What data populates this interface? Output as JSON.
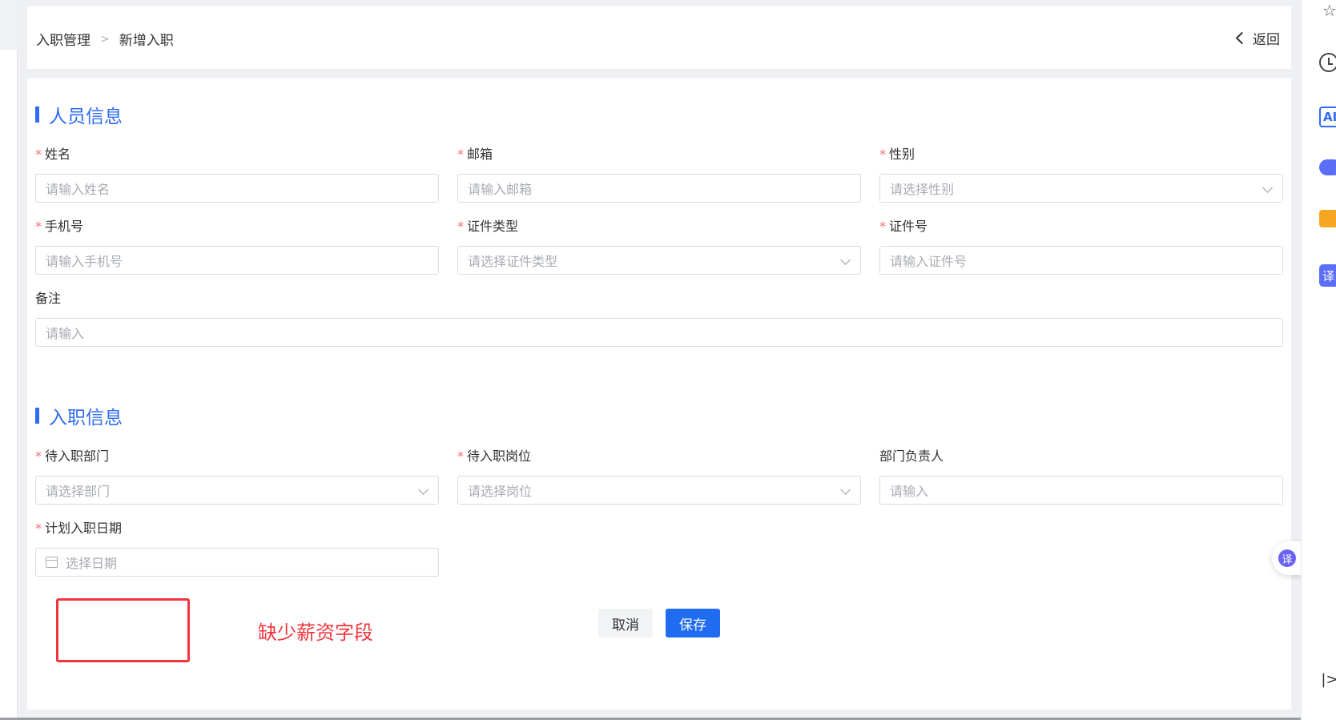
{
  "breadcrumb": {
    "parent": "入职管理",
    "current": "新增入职"
  },
  "back_label": "返回",
  "personal": {
    "title": "人员信息",
    "name": {
      "label": "姓名",
      "placeholder": "请输入姓名"
    },
    "email": {
      "label": "邮箱",
      "placeholder": "请输入邮箱"
    },
    "gender": {
      "label": "性别",
      "placeholder": "请选择性别"
    },
    "phone": {
      "label": "手机号",
      "placeholder": "请输入手机号"
    },
    "id_type": {
      "label": "证件类型",
      "placeholder": "请选择证件类型"
    },
    "id_number": {
      "label": "证件号",
      "placeholder": "请输入证件号"
    },
    "remark": {
      "label": "备注",
      "placeholder": "请输入"
    }
  },
  "onboarding": {
    "title": "入职信息",
    "department": {
      "label": "待入职部门",
      "placeholder": "请选择部门"
    },
    "position": {
      "label": "待入职岗位",
      "placeholder": "请选择岗位"
    },
    "manager": {
      "label": "部门负责人",
      "placeholder": "请输入"
    },
    "planned_date": {
      "label": "计划入职日期",
      "placeholder": "选择日期"
    }
  },
  "required_mark": "*",
  "annotation": {
    "text": "缺少薪资字段",
    "color": "#f2353b"
  },
  "buttons": {
    "cancel": "取消",
    "save": "保存"
  },
  "rail": {
    "ai_label": "AI",
    "translate_label": "译",
    "collapse_label": "|>",
    "star_glyph": "☆"
  },
  "colors": {
    "accent": "#2f6bf5",
    "primary_button": "#1f6cf0",
    "required": "#f56c6c"
  }
}
